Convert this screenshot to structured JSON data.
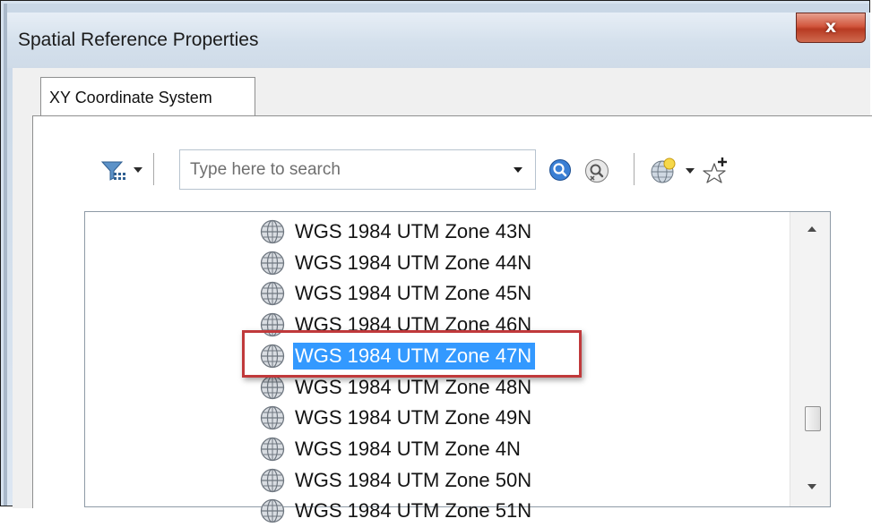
{
  "window": {
    "title": "Spatial Reference Properties",
    "close_label": "x"
  },
  "tabs": [
    {
      "label": "XY Coordinate System",
      "selected": true
    }
  ],
  "toolbar": {
    "filter_icon": "filter-icon",
    "search": {
      "placeholder": "Type here to search",
      "value": ""
    },
    "search_icon": "search-icon",
    "clear_search_icon": "clear-search-icon",
    "globe_icon": "new-coordinate-system-globe-icon",
    "favorites_icon": "add-to-favorites-icon"
  },
  "list": {
    "items": [
      {
        "label": "WGS 1984 UTM Zone 43N",
        "selected": false
      },
      {
        "label": "WGS 1984 UTM Zone 44N",
        "selected": false
      },
      {
        "label": "WGS 1984 UTM Zone 45N",
        "selected": false
      },
      {
        "label": "WGS 1984 UTM Zone 46N",
        "selected": false
      },
      {
        "label": "WGS 1984 UTM Zone 47N",
        "selected": true
      },
      {
        "label": "WGS 1984 UTM Zone 48N",
        "selected": false
      },
      {
        "label": "WGS 1984 UTM Zone 49N",
        "selected": false
      },
      {
        "label": "WGS 1984 UTM Zone 4N",
        "selected": false
      },
      {
        "label": "WGS 1984 UTM Zone 50N",
        "selected": false
      },
      {
        "label": "WGS 1984 UTM Zone 51N",
        "selected": false
      }
    ]
  },
  "colors": {
    "selection": "#3399ff",
    "annotation_box": "#c0393b"
  }
}
